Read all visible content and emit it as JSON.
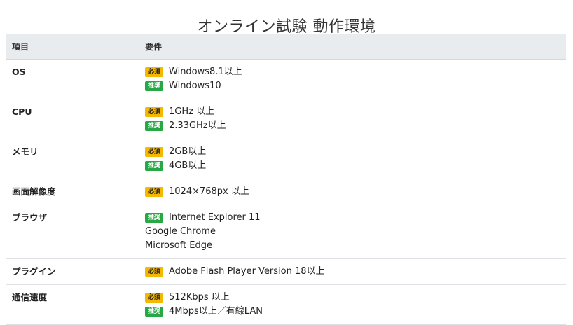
{
  "title": "オンライン試験 動作環境",
  "headers": {
    "item": "項目",
    "requirement": "要件"
  },
  "badge_colors": {
    "must": "#f5b800",
    "rec": "#28a745"
  },
  "rows": [
    {
      "item": "OS",
      "lines": [
        {
          "badge": "必須",
          "type": "must",
          "text": "Windows8.1以上"
        },
        {
          "badge": "推奨",
          "type": "rec",
          "text": "Windows10"
        }
      ]
    },
    {
      "item": "CPU",
      "lines": [
        {
          "badge": "必須",
          "type": "must",
          "text": "1GHz 以上"
        },
        {
          "badge": "推奨",
          "type": "rec",
          "text": "2.33GHz以上"
        }
      ]
    },
    {
      "item": "メモリ",
      "lines": [
        {
          "badge": "必須",
          "type": "must",
          "text": "2GB以上"
        },
        {
          "badge": "推奨",
          "type": "rec",
          "text": "4GB以上"
        }
      ]
    },
    {
      "item": "画面解像度",
      "lines": [
        {
          "badge": "必須",
          "type": "must",
          "text": "1024×768px 以上"
        }
      ]
    },
    {
      "item": "ブラウザ",
      "lines": [
        {
          "badge": "推奨",
          "type": "rec",
          "text": "Internet Explorer 11"
        },
        {
          "badge": "",
          "type": "",
          "text": "Google Chrome"
        },
        {
          "badge": "",
          "type": "",
          "text": "Microsoft Edge"
        }
      ]
    },
    {
      "item": "プラグイン",
      "lines": [
        {
          "badge": "必須",
          "type": "must",
          "text": "Adobe Flash Player Version 18以上"
        }
      ]
    },
    {
      "item": "通信速度",
      "lines": [
        {
          "badge": "必須",
          "type": "must",
          "text": "512Kbps 以上"
        },
        {
          "badge": "推奨",
          "type": "rec",
          "text": "4Mbps以上／有線LAN"
        }
      ]
    }
  ]
}
